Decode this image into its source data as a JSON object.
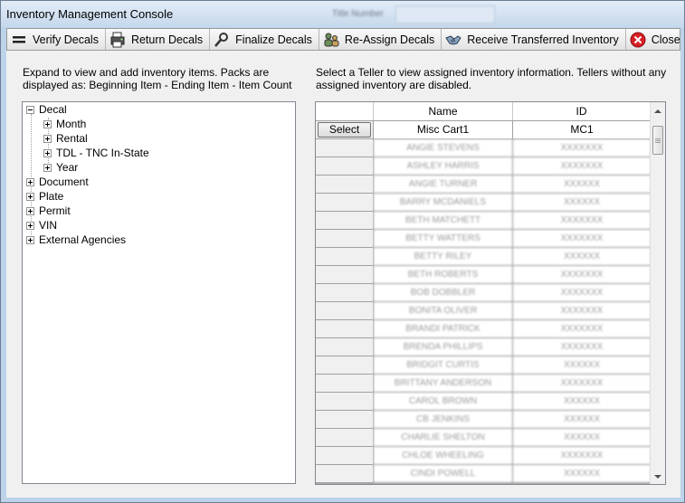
{
  "window": {
    "title": "Inventory Management Console",
    "blurred_header_label": "Title Number"
  },
  "toolbar": {
    "buttons": [
      {
        "label": "Verify Decals",
        "icon": "menu-lines-icon"
      },
      {
        "label": "Return Decals",
        "icon": "printer-return-icon"
      },
      {
        "label": "Finalize Decals",
        "icon": "finalize-tool-icon"
      },
      {
        "label": "Re-Assign Decals",
        "icon": "reassign-people-icon"
      },
      {
        "label": "Receive Transferred Inventory",
        "icon": "handshake-icon"
      },
      {
        "label": "Close",
        "icon": "close-circle-icon"
      }
    ]
  },
  "left_panel": {
    "instructions": [
      "Expand to view and add inventory items.  Packs are",
      "displayed as:  Beginning Item - Ending Item - Item Count"
    ],
    "tree": [
      {
        "label": "Decal",
        "expanded": true,
        "children": [
          "Month",
          "Rental",
          "TDL - TNC In-State",
          "Year"
        ]
      },
      {
        "label": "Document",
        "expanded": false
      },
      {
        "label": "Plate",
        "expanded": false
      },
      {
        "label": "Permit",
        "expanded": false
      },
      {
        "label": "VIN",
        "expanded": false
      },
      {
        "label": "External Agencies",
        "expanded": false
      }
    ]
  },
  "right_panel": {
    "instructions": [
      "Select a Teller to view assigned inventory information.  Tellers without any",
      "assigned inventory are disabled."
    ],
    "grid": {
      "columns": [
        "Name",
        "ID"
      ],
      "select_label": "Select",
      "rows": [
        {
          "name": "Misc Cart1",
          "id": "MC1"
        },
        {
          "name": "ANGIE STEVENS",
          "id": "XXXXXXX"
        },
        {
          "name": "ASHLEY HARRIS",
          "id": "XXXXXXX"
        },
        {
          "name": "ANGIE TURNER",
          "id": "XXXXXX"
        },
        {
          "name": "BARRY MCDANIELS",
          "id": "XXXXXX"
        },
        {
          "name": "BETH MATCHETT",
          "id": "XXXXXXX"
        },
        {
          "name": "BETTY WATTERS",
          "id": "XXXXXXX"
        },
        {
          "name": "BETTY RILEY",
          "id": "XXXXXX"
        },
        {
          "name": "BETH ROBERTS",
          "id": "XXXXXXX"
        },
        {
          "name": "BOB DOBBLER",
          "id": "XXXXXXX"
        },
        {
          "name": "BONITA OLIVER",
          "id": "XXXXXXX"
        },
        {
          "name": "BRANDI PATRICK",
          "id": "XXXXXXX"
        },
        {
          "name": "BRENDA PHILLIPS",
          "id": "XXXXXXX"
        },
        {
          "name": "BRIDGIT CURTIS",
          "id": "XXXXXX"
        },
        {
          "name": "BRITTANY ANDERSON",
          "id": "XXXXXXX"
        },
        {
          "name": "CAROL BROWN",
          "id": "XXXXXX"
        },
        {
          "name": "CB JENKINS",
          "id": "XXXXXX"
        },
        {
          "name": "CHARLIE SHELTON",
          "id": "XXXXXX"
        },
        {
          "name": "CHLOE WHEELING",
          "id": "XXXXXXX"
        },
        {
          "name": "CINDI POWELL",
          "id": "XXXXXX"
        }
      ]
    }
  }
}
